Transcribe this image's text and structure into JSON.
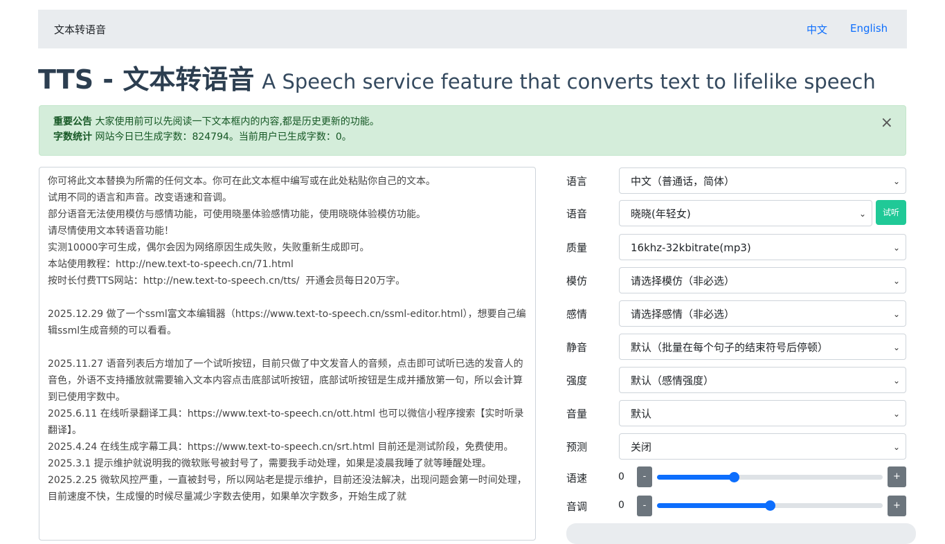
{
  "nav": {
    "brand": "文本转语音",
    "links": [
      "中文",
      "English"
    ]
  },
  "header": {
    "title": "TTS - 文本转语音",
    "subtitle": "A Speech service feature that converts text to lifelike speech"
  },
  "notice": {
    "label1": "重要公告",
    "text1": "大家使用前可以先阅读一下文本框内的内容,都是历史更新的功能。",
    "label2": "字数统计",
    "text2": "网站今日已生成字数：824794。当前用户已生成字数：0。",
    "close": "×"
  },
  "textarea": {
    "content": "你可将此文本替换为所需的任何文本。你可在此文本框中编写或在此处粘贴你自己的文本。\n试用不同的语言和声音。改变语速和音调。\n部分语音无法使用模仿与感情功能，可使用晓墨体验感情功能，使用晓晓体验模仿功能。\n请尽情使用文本转语音功能！\n实测10000字可生成，偶尔会因为网络原因生成失败，失败重新生成即可。\n本站使用教程：http://new.text-to-speech.cn/71.html\n按时长付费TTS网站：http://new.text-to-speech.cn/tts/  开通会员每日20万字。\n\n2025.12.29 做了一个ssml富文本编辑器（https://www.text-to-speech.cn/ssml-editor.html），想要自己编辑ssml生成音频的可以看看。\n\n2025.11.27 语音列表后方增加了一个试听按钮，目前只做了中文发音人的音频，点击即可试听已选的发音人的音色，外语不支持播放就需要输入文本内容点击底部试听按钮，底部试听按钮是生成并播放第一句，所以会计算到已使用字数中。\n2025.6.11 在线听录翻译工具：https://www.text-to-speech.cn/ott.html 也可以微信小程序搜索【实时听录翻译】。\n2025.4.24 在线生成字幕工具：https://www.text-to-speech.cn/srt.html 目前还是测试阶段，免费使用。\n2025.3.1 提示维护就说明我的微软账号被封号了，需要我手动处理，如果是凌晨我睡了就等睡醒处理。\n2025.2.25 微软风控严重，一直被封号，所以网站老是提示维护，目前还没法解决，出现问题会第一时间处理，目前速度不快，生成慢的时候尽量减少字数去使用，如果单次字数多，开始生成了就"
  },
  "form": {
    "language_label": "语言",
    "language_value": "中文（普通话，简体）",
    "voice_label": "语音",
    "voice_value": "晓晓(年轻女)",
    "listen_button": "试听",
    "quality_label": "质量",
    "quality_value": "16khz-32kbitrate(mp3)",
    "imitate_label": "模仿",
    "imitate_value": "请选择模仿（非必选）",
    "emotion_label": "感情",
    "emotion_value": "请选择感情（非必选）",
    "silence_label": "静音",
    "silence_value": "默认（批量在每个句子的结束符号后停顿）",
    "intensity_label": "强度",
    "intensity_value": "默认（感情强度）",
    "volume_label": "音量",
    "volume_value": "默认",
    "predict_label": "预测",
    "predict_value": "关闭",
    "rate_label": "语速",
    "rate_value": "0",
    "rate_fraction": 0.34,
    "pitch_label": "音调",
    "pitch_value": "0",
    "pitch_fraction": 0.5,
    "minus": "-",
    "plus": "+"
  },
  "colors": {
    "accent": "#0d6efd",
    "success_bg": "#d4edda",
    "listen_button": "#20c997",
    "step_button": "#6c757d"
  }
}
